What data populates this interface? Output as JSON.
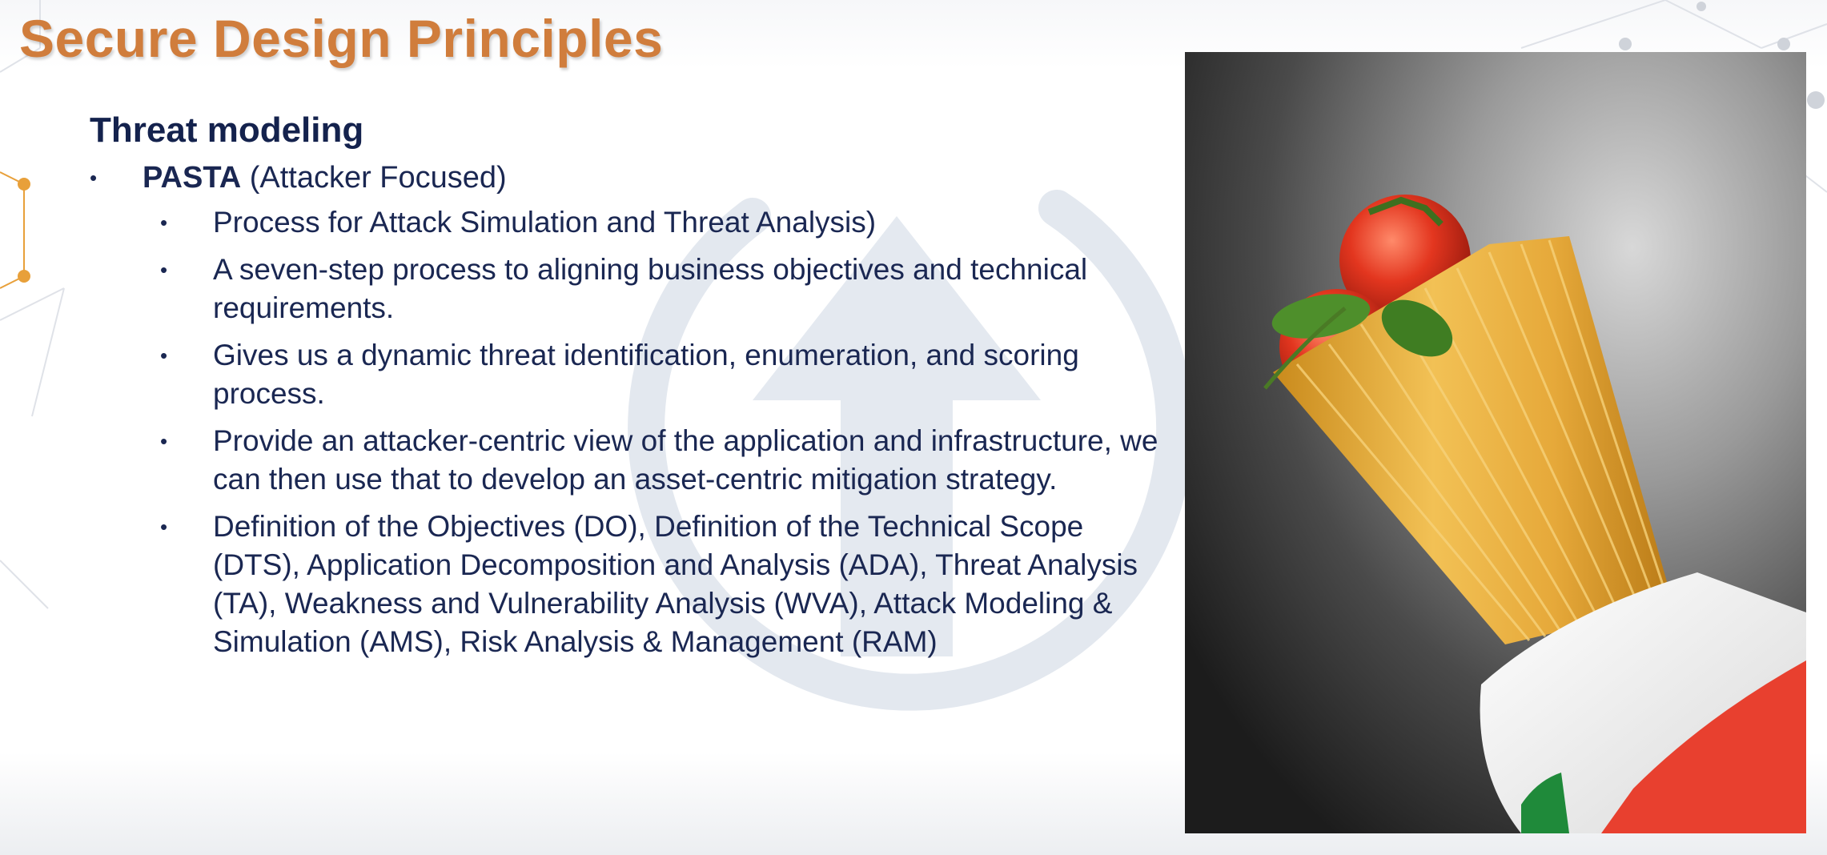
{
  "slide": {
    "title": "Secure Design Principles",
    "heading": "Threat modeling",
    "main_bullet": {
      "bold": "PASTA",
      "rest": " (Attacker Focused)"
    },
    "sub_bullets": [
      "Process for Attack Simulation and Threat Analysis)",
      "A seven-step process to aligning business objectives and technical requirements.",
      "Gives us a dynamic threat identification, enumeration, and scoring process.",
      "Provide an attacker-centric view of the application and infrastructure, we can then use that to develop an asset-centric mitigation strategy.",
      "Definition of the Objectives (DO), Definition of the Technical Scope (DTS), Application Decomposition and Analysis (ADA), Threat Analysis (TA), Weakness and Vulnerability Analysis (WVA), Attack Modeling & Simulation (AMS), Risk Analysis & Management (RAM)"
    ],
    "bullet_glyph": "•"
  },
  "photo": {
    "subject": "spaghetti-with-tomatoes-and-italian-flag-photo"
  },
  "decor": {
    "title_color": "#d07d3c",
    "text_color": "#1a2752",
    "accent_orange": "#e8a03a",
    "watermark_icon": "upload-arrow-circle-icon"
  }
}
